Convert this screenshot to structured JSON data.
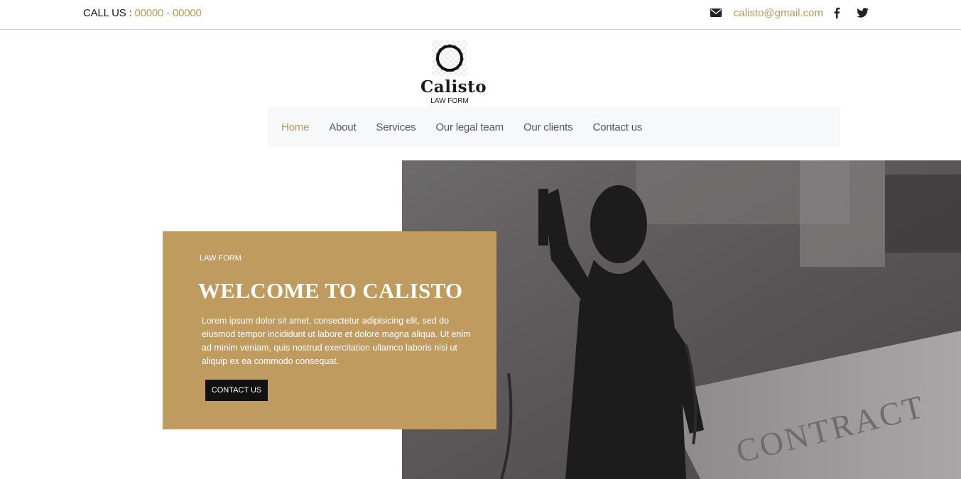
{
  "topbar": {
    "call_label": "CALL US : ",
    "phone": "00000 - 00000",
    "email": "calisto@gmail.com",
    "icons": [
      "envelope-icon",
      "facebook-icon",
      "twitter-icon"
    ]
  },
  "logo": {
    "name": "Calisto",
    "subtitle": "LAW FORM"
  },
  "nav": {
    "items": [
      {
        "label": "Home",
        "active": true
      },
      {
        "label": "About",
        "active": false
      },
      {
        "label": "Services",
        "active": false
      },
      {
        "label": "Our legal team",
        "active": false
      },
      {
        "label": "Our clients",
        "active": false
      },
      {
        "label": "Contact us",
        "active": false
      }
    ]
  },
  "hero": {
    "kicker": "LAW FORM",
    "title": "WELCOME TO CALISTO",
    "body": "Lorem ipsum dolor sit amet, consectetur adipisicing elit, sed do eiusmod tempor incididunt ut labore et dolore magna aliqua. Ut enim ad minim veniam, quis nostrud exercitation ullamco laboris nisi ut aliquip ex ea commodo consequat.",
    "button_label": "CONTACT US",
    "image_subject": "lady-justice-statue",
    "image_text": "CONTRACT"
  },
  "colors": {
    "accent": "#b8995f",
    "hero_box": "#bf9b60",
    "button": "#111111",
    "nav_bg": "#f7f8f9"
  }
}
